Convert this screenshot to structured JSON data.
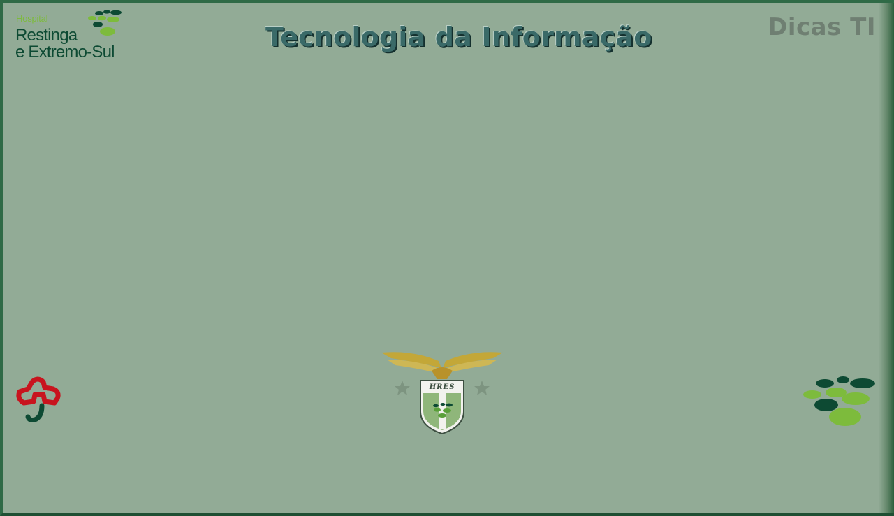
{
  "brand": {
    "small_label": "Hospital",
    "name_line1": "Restinga",
    "name_line2": "e Extremo-Sul",
    "logo_icon": "green-dots-logo-icon",
    "colors": {
      "dark_green": "#0d4a33",
      "light_green": "#7dbb3c",
      "medium_green": "#5aa03a"
    }
  },
  "header": {
    "title": "Tecnologia da Informação",
    "corner_label": "Dicas TI"
  },
  "emblems": {
    "left_icon": "red-green-cross-icon",
    "center_crest_text": "HRES",
    "center_icon": "winged-shield-crest-icon",
    "right_icon": "green-dots-logo-icon"
  },
  "theme": {
    "background": "#92ab96",
    "frame": "#2f6a46"
  }
}
